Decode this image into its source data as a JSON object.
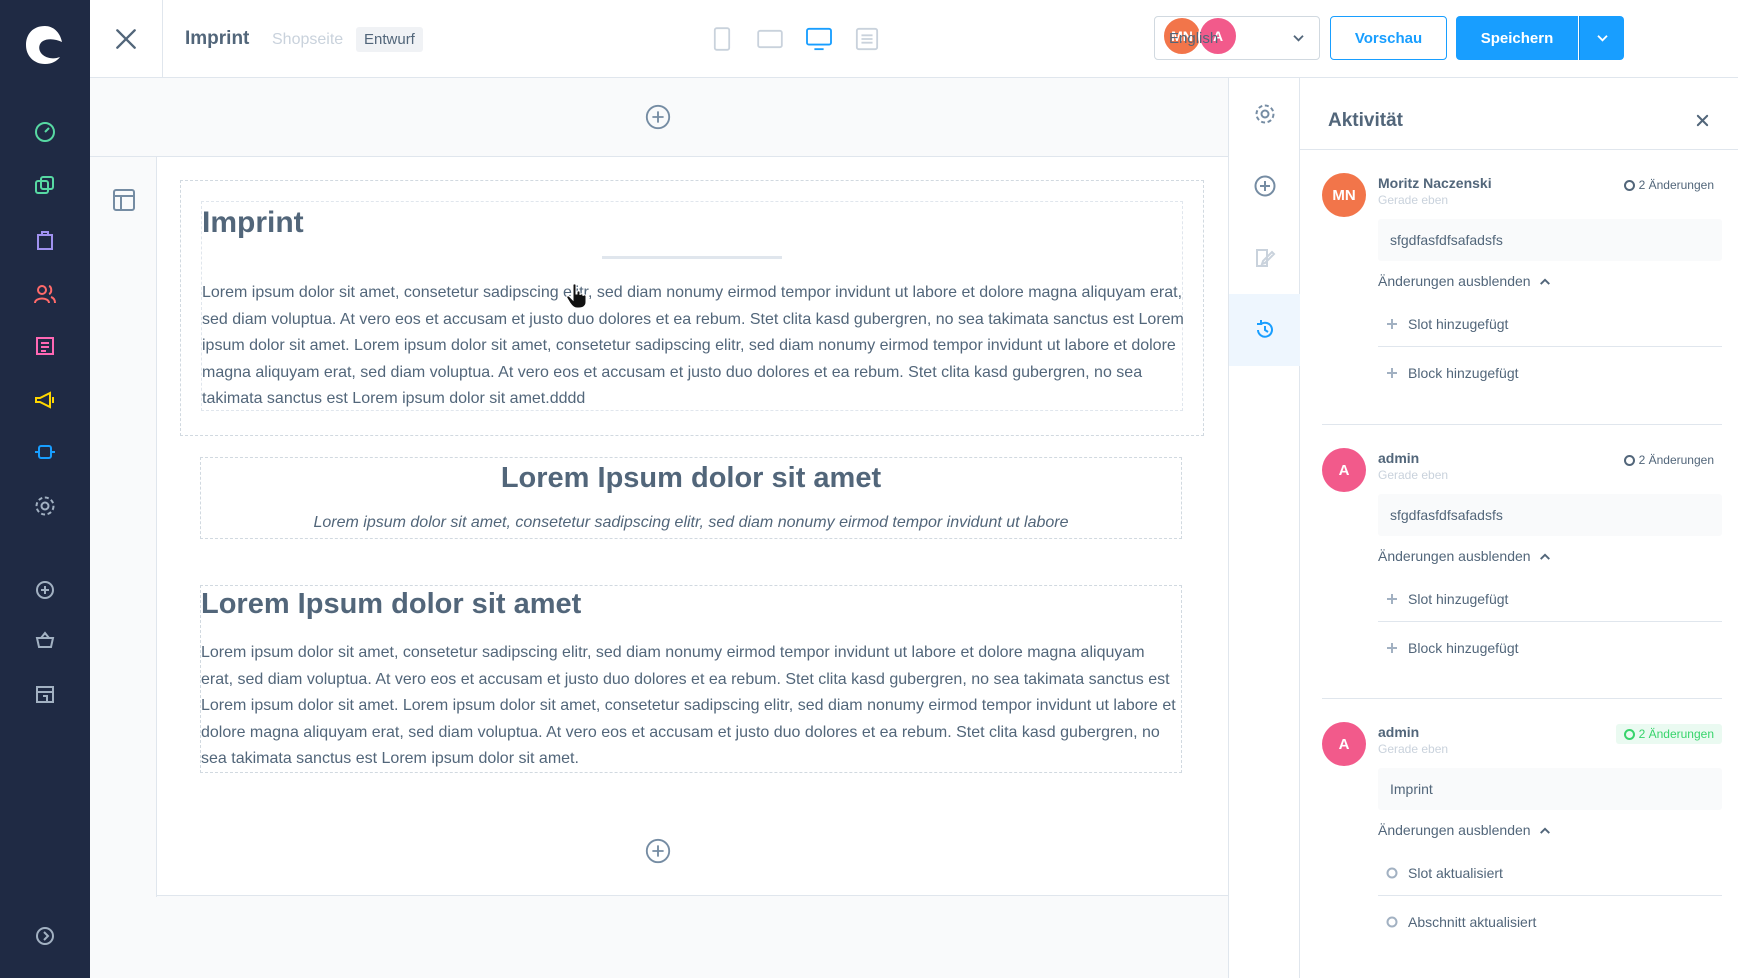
{
  "topbar": {
    "title": "Imprint",
    "page_type": "Shopseite",
    "status_badge": "Entwurf",
    "language": "English",
    "preview_label": "Vorschau",
    "save_label": "Speichern",
    "avatars": [
      {
        "initials": "MN",
        "color": "#f2754a"
      },
      {
        "initials": "A",
        "color": "#f25a8b"
      }
    ]
  },
  "canvas": {
    "block1": {
      "heading": "Imprint",
      "text": "Lorem ipsum dolor sit amet, consetetur sadipscing elitr, sed diam nonumy eirmod tempor invidunt ut labore et dolore magna aliquyam erat, sed diam voluptua. At vero eos et accusam et justo duo dolores et ea rebum. Stet clita kasd gubergren, no sea takimata sanctus est Lorem ipsum dolor sit amet. Lorem ipsum dolor sit amet, consetetur sadipscing elitr, sed diam nonumy eirmod tempor invidunt ut labore et dolore magna aliquyam erat, sed diam voluptua. At vero eos et accusam et justo duo dolores et ea rebum. Stet clita kasd gubergren, no sea takimata sanctus est Lorem ipsum dolor sit amet.dddd"
    },
    "block2": {
      "heading": "Lorem Ipsum dolor sit amet",
      "subtext": "Lorem ipsum dolor sit amet, consetetur sadipscing elitr, sed diam nonumy eirmod tempor invidunt ut labore"
    },
    "block3": {
      "heading": "Lorem Ipsum dolor sit amet",
      "text": "Lorem ipsum dolor sit amet, consetetur sadipscing elitr, sed diam nonumy eirmod tempor invidunt ut labore et dolore magna aliquyam erat, sed diam voluptua. At vero eos et accusam et justo duo dolores et ea rebum. Stet clita kasd gubergren, no sea takimata sanctus est Lorem ipsum dolor sit amet. Lorem ipsum dolor sit amet, consetetur sadipscing elitr, sed diam nonumy eirmod tempor invidunt ut labore et dolore magna aliquyam erat, sed diam voluptua. At vero eos et accusam et justo duo dolores et ea rebum. Stet clita kasd gubergren, no sea takimata sanctus est Lorem ipsum dolor sit amet."
    }
  },
  "activity": {
    "title": "Aktivität",
    "entries": [
      {
        "initials": "MN",
        "avatar_color": "#f2754a",
        "name": "Moritz Naczenski",
        "time": "Gerade eben",
        "count": "2 Änderungen",
        "message": "sfgdfasfdfsafadsfs",
        "toggle": "Änderungen ausblenden",
        "changes": [
          "Slot hinzugefügt",
          "Block hinzugefügt"
        ]
      },
      {
        "initials": "A",
        "avatar_color": "#f25a8b",
        "name": "admin",
        "time": "Gerade eben",
        "count": "2 Änderungen",
        "message": "sfgdfasfdfsafadsfs",
        "toggle": "Änderungen ausblenden",
        "changes": [
          "Slot hinzugefügt",
          "Block hinzugefügt"
        ]
      },
      {
        "initials": "A",
        "avatar_color": "#f25a8b",
        "name": "admin",
        "time": "Gerade eben",
        "count": "2 Änderungen",
        "message": "Imprint",
        "toggle": "Änderungen ausblenden",
        "changes": [
          "Slot aktualisiert",
          "Abschnitt aktualisiert"
        ]
      }
    ]
  },
  "colors": {
    "nav_bg": "#1f2a44",
    "accent": "#189eff",
    "text": "#52667a",
    "success": "#37d46b"
  }
}
